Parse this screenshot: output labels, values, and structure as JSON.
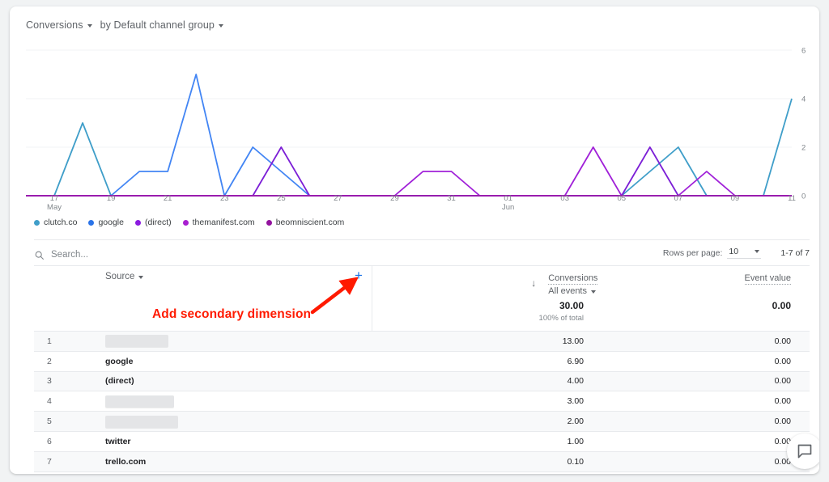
{
  "chart_header": {
    "metric_label": "Conversions",
    "by_label": "by Default channel group",
    "metric_caret": "chevron-down-icon",
    "dimension_caret": "chevron-down-icon"
  },
  "chart_data": {
    "type": "line",
    "title": "Conversions by Default channel group",
    "xlabel": "",
    "ylabel": "",
    "ylim": [
      0,
      6
    ],
    "yticks": [
      0,
      2,
      4,
      6
    ],
    "grid": true,
    "legend_position": "bottom-left",
    "x": [
      "16",
      "17",
      "18",
      "19",
      "20",
      "21",
      "22",
      "23",
      "24",
      "25",
      "26",
      "27",
      "28",
      "29",
      "30",
      "31",
      "01",
      "02",
      "03",
      "04",
      "05",
      "06",
      "07",
      "08",
      "09",
      "10",
      "11",
      "12"
    ],
    "tick_labels": [
      {
        "value": "17",
        "sub": "May"
      },
      {
        "value": "19",
        "sub": ""
      },
      {
        "value": "21",
        "sub": ""
      },
      {
        "value": "23",
        "sub": ""
      },
      {
        "value": "25",
        "sub": ""
      },
      {
        "value": "27",
        "sub": ""
      },
      {
        "value": "29",
        "sub": ""
      },
      {
        "value": "31",
        "sub": ""
      },
      {
        "value": "01",
        "sub": "Jun"
      },
      {
        "value": "03",
        "sub": ""
      },
      {
        "value": "05",
        "sub": ""
      },
      {
        "value": "07",
        "sub": ""
      },
      {
        "value": "09",
        "sub": ""
      },
      {
        "value": "11",
        "sub": ""
      }
    ],
    "series": [
      {
        "name": "clutch.co",
        "color": "#3f9ec9",
        "values": [
          0,
          0,
          3,
          0,
          0,
          0,
          0,
          0,
          0,
          0,
          0,
          0,
          0,
          0,
          0,
          0,
          0,
          0,
          0,
          0,
          0,
          0,
          1,
          2,
          0,
          0,
          0,
          4
        ]
      },
      {
        "name": "google",
        "color": "#4285f4",
        "values": [
          0,
          0,
          0,
          0,
          1,
          1,
          5,
          0,
          2,
          1,
          0,
          0,
          0,
          0,
          0,
          0,
          0,
          0,
          0,
          0,
          0,
          0,
          0,
          0,
          0,
          0,
          0,
          0
        ]
      },
      {
        "name": "(direct)",
        "color": "#7c1fd6",
        "values": [
          0,
          0,
          0,
          0,
          0,
          0,
          0,
          0,
          0,
          2,
          0,
          0,
          0,
          0,
          0,
          0,
          0,
          0,
          0,
          0,
          0,
          0,
          2,
          0,
          0,
          0,
          0,
          0
        ]
      },
      {
        "name": "themanifest.com",
        "color": "#a020d8",
        "values": [
          0,
          0,
          0,
          0,
          0,
          0,
          0,
          0,
          0,
          0,
          0,
          0,
          0,
          0,
          1,
          1,
          0,
          0,
          0,
          0,
          2,
          0,
          0,
          0,
          1,
          0,
          0,
          0
        ]
      },
      {
        "name": "beomniscient.com",
        "color": "#9b1ba8",
        "values": [
          0,
          0,
          0,
          0,
          0,
          0,
          0,
          0,
          0,
          0,
          0,
          0,
          0,
          0,
          0,
          0,
          0,
          0,
          0,
          0,
          0,
          0,
          0,
          0,
          0,
          0,
          0,
          0
        ]
      }
    ]
  },
  "legend": [
    {
      "label": "clutch.co",
      "color": "#3f9ec9"
    },
    {
      "label": "google",
      "color": "#2a73e8"
    },
    {
      "label": "(direct)",
      "color": "#8b1ae0"
    },
    {
      "label": "themanifest.com",
      "color": "#a81fd0"
    },
    {
      "label": "beomniscient.com",
      "color": "#93129e"
    }
  ],
  "search": {
    "placeholder": "Search...",
    "value": "",
    "icon": "search-icon"
  },
  "pagination": {
    "rows_per_page_label": "Rows per page:",
    "rows_per_page_value": "10",
    "range": "1-7 of 7"
  },
  "table": {
    "dimension_header": "Source",
    "dimension_caret": "chevron-down-icon",
    "add_dimension_icon": "+",
    "metrics": [
      {
        "name": "Conversions",
        "sub": "All events",
        "sorted": true,
        "sort_icon": "arrow-down-icon"
      },
      {
        "name": "Event value",
        "sub": "",
        "sorted": false
      }
    ],
    "totals": {
      "conversions": "30.00",
      "conversions_sub": "100% of total",
      "event_value": "0.00"
    },
    "rows": [
      {
        "index": "1",
        "source": "",
        "redacted": true,
        "redact_width": 78,
        "conversions": "13.00",
        "event_value": "0.00"
      },
      {
        "index": "2",
        "source": "google",
        "redacted": false,
        "conversions": "6.90",
        "event_value": "0.00"
      },
      {
        "index": "3",
        "source": "(direct)",
        "redacted": false,
        "conversions": "4.00",
        "event_value": "0.00"
      },
      {
        "index": "4",
        "source": "",
        "redacted": true,
        "redact_width": 85,
        "conversions": "3.00",
        "event_value": "0.00"
      },
      {
        "index": "5",
        "source": "",
        "redacted": true,
        "redact_width": 90,
        "conversions": "2.00",
        "event_value": "0.00"
      },
      {
        "index": "6",
        "source": "twitter",
        "redacted": false,
        "conversions": "1.00",
        "event_value": "0.00"
      },
      {
        "index": "7",
        "source": "trello.com",
        "redacted": false,
        "conversions": "0.10",
        "event_value": "0.00"
      }
    ]
  },
  "annotation": {
    "text": "Add secondary dimension",
    "color": "#ff1a00",
    "arrow": "arrow-up-right-icon"
  },
  "feedback": {
    "icon": "feedback-bubble-icon"
  }
}
